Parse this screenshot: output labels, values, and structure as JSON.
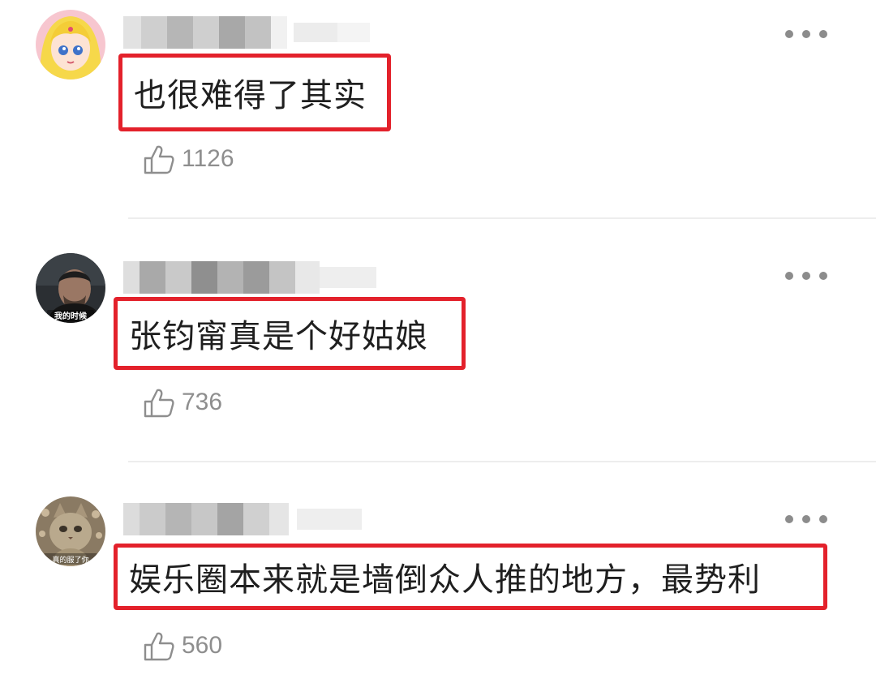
{
  "comments": [
    {
      "avatar": "sailor-moon-avatar",
      "text": "也很难得了其实",
      "likes": "1126"
    },
    {
      "avatar": "dark-portrait-avatar",
      "avatar_caption": "我的时候",
      "text": "张钧甯真是个好姑娘",
      "likes": "736"
    },
    {
      "avatar": "cat-avatar",
      "avatar_caption": "真的服了你",
      "text": "娱乐圈本来就是墙倒众人推的地方，最势利",
      "likes": "560"
    }
  ],
  "icons": {
    "more": "more-dots-icon",
    "like": "thumbs-up-icon"
  },
  "colors": {
    "highlight": "#e3212b",
    "muted": "#8e8e8e",
    "text": "#1f1f1f"
  }
}
